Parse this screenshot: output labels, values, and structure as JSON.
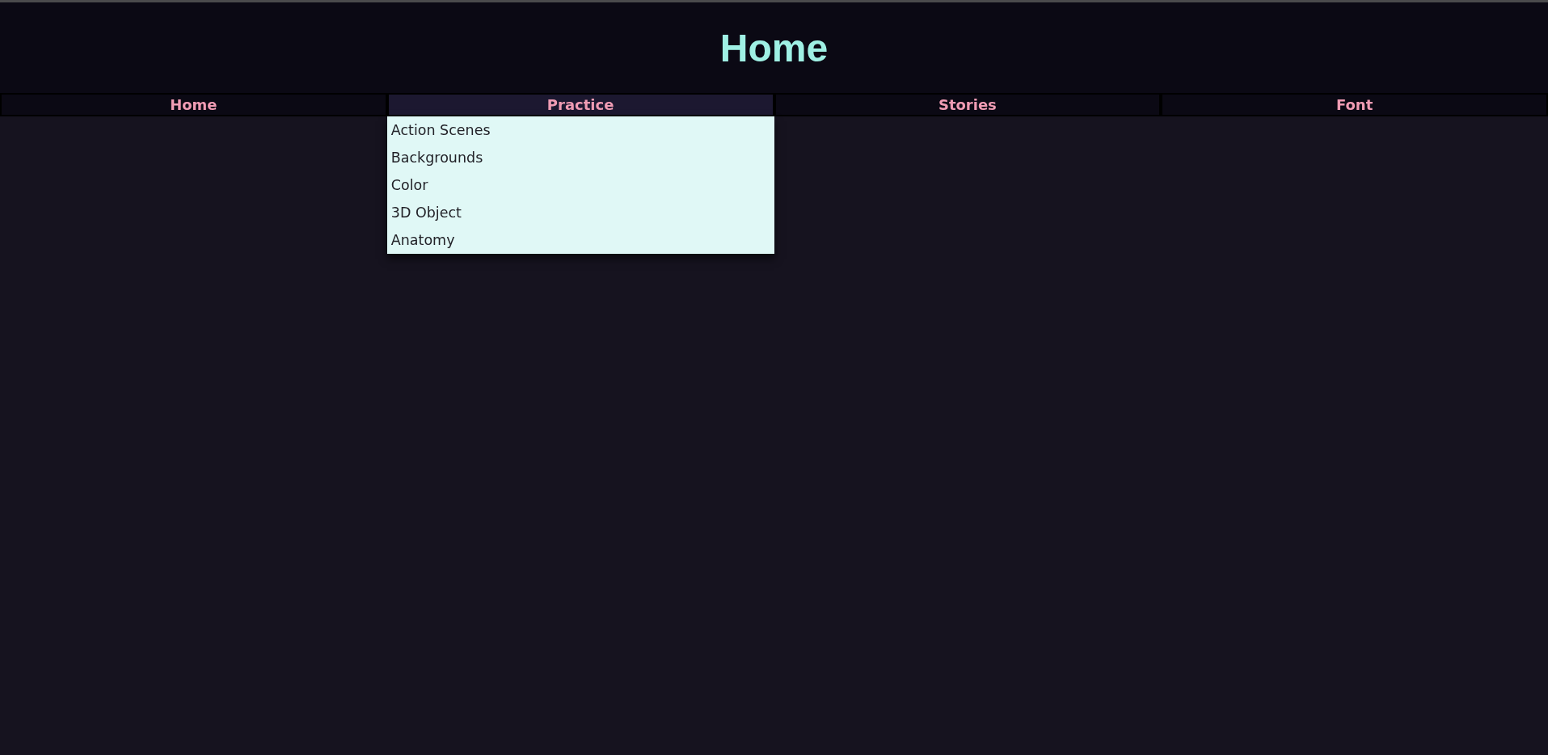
{
  "header": {
    "title": "Home"
  },
  "nav": {
    "tabs": [
      {
        "label": "Home",
        "selected": false
      },
      {
        "label": "Practice",
        "selected": true,
        "dropdown": [
          "Action Scenes",
          "Backgrounds",
          "Color",
          "3D Object",
          "Anatomy"
        ]
      },
      {
        "label": "Stories",
        "selected": false
      },
      {
        "label": "Font",
        "selected": false
      }
    ]
  }
}
